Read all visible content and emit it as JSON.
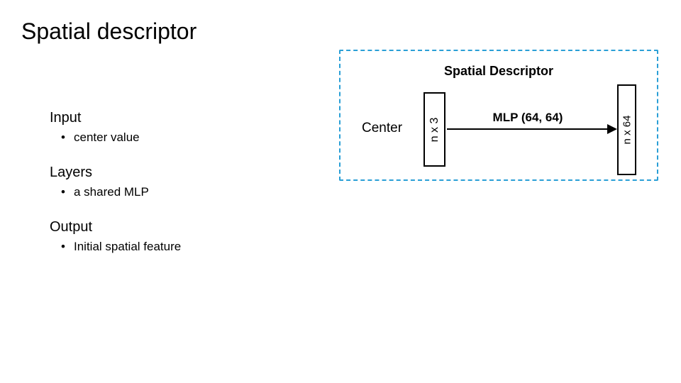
{
  "title": "Spatial descriptor",
  "sections": {
    "input": {
      "label": "Input",
      "bullet": "center value"
    },
    "layers": {
      "label": "Layers",
      "bullet": "a shared MLP"
    },
    "output": {
      "label": "Output",
      "bullet": "Initial spatial feature"
    }
  },
  "diagram": {
    "title": "Spatial Descriptor",
    "center_label": "Center",
    "block_in": "n x 3",
    "mlp_label": "MLP (64, 64)",
    "block_out": "n x 64"
  }
}
